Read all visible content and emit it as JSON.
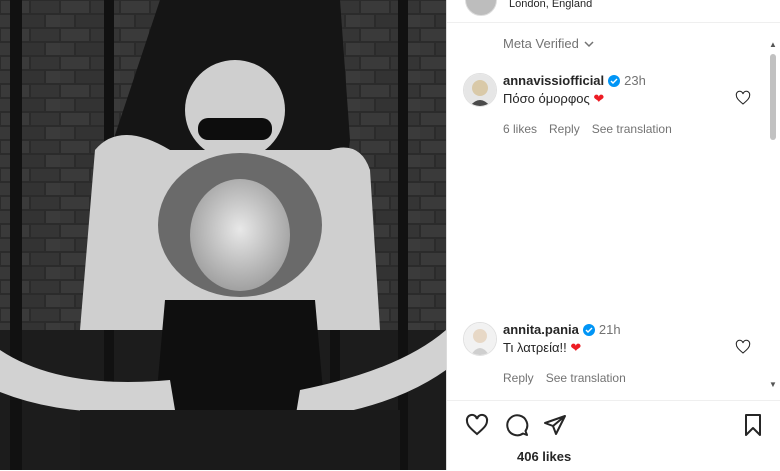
{
  "header": {
    "location": "London, England"
  },
  "meta_verified": {
    "label": "Meta Verified"
  },
  "comments": [
    {
      "username": "annavissiofficial",
      "time": "23h",
      "text": "Πόσο όμορφος ",
      "likes_label": "6 likes",
      "reply_label": "Reply",
      "translation_label": "See translation"
    },
    {
      "username": "annita.pania",
      "time": "21h",
      "text": "Τι λατρεία!!",
      "reply_label": "Reply",
      "translation_label": "See translation"
    }
  ],
  "post": {
    "likes": "406 likes"
  },
  "colors": {
    "verified_badge": "#0095f6",
    "heart_red": "#ed1c24",
    "muted_text": "#737373"
  },
  "icons": [
    "heart-icon",
    "comment-icon",
    "share-icon",
    "bookmark-icon",
    "chevron-down-icon",
    "verified-badge-icon"
  ]
}
